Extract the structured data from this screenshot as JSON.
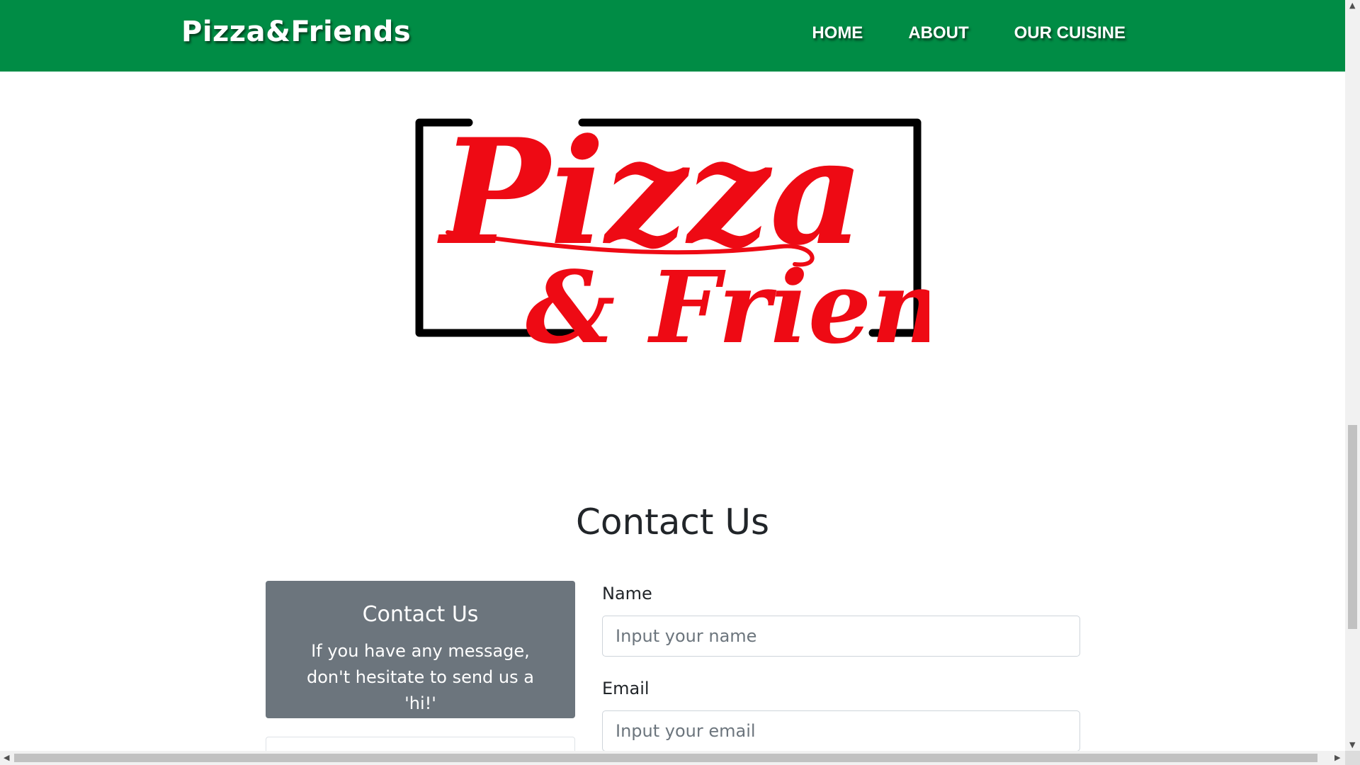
{
  "navbar": {
    "brand": "Pizza&Friends",
    "links": [
      "HOME",
      "ABOUT",
      "OUR CUISINE"
    ]
  },
  "logo": {
    "line1": "Pizza",
    "line2": "& Friends"
  },
  "contact": {
    "title": "Contact Us",
    "card_title": "Contact Us",
    "card_text": "If you have any message, don't hesitate to send us a 'hi!'",
    "name_label": "Name",
    "name_placeholder": "Input your name",
    "email_label": "Email",
    "email_placeholder": "Input your email"
  },
  "colors": {
    "navbar": "#008c45",
    "logo_red": "#ee0a14",
    "card_gray": "#6c757d"
  }
}
